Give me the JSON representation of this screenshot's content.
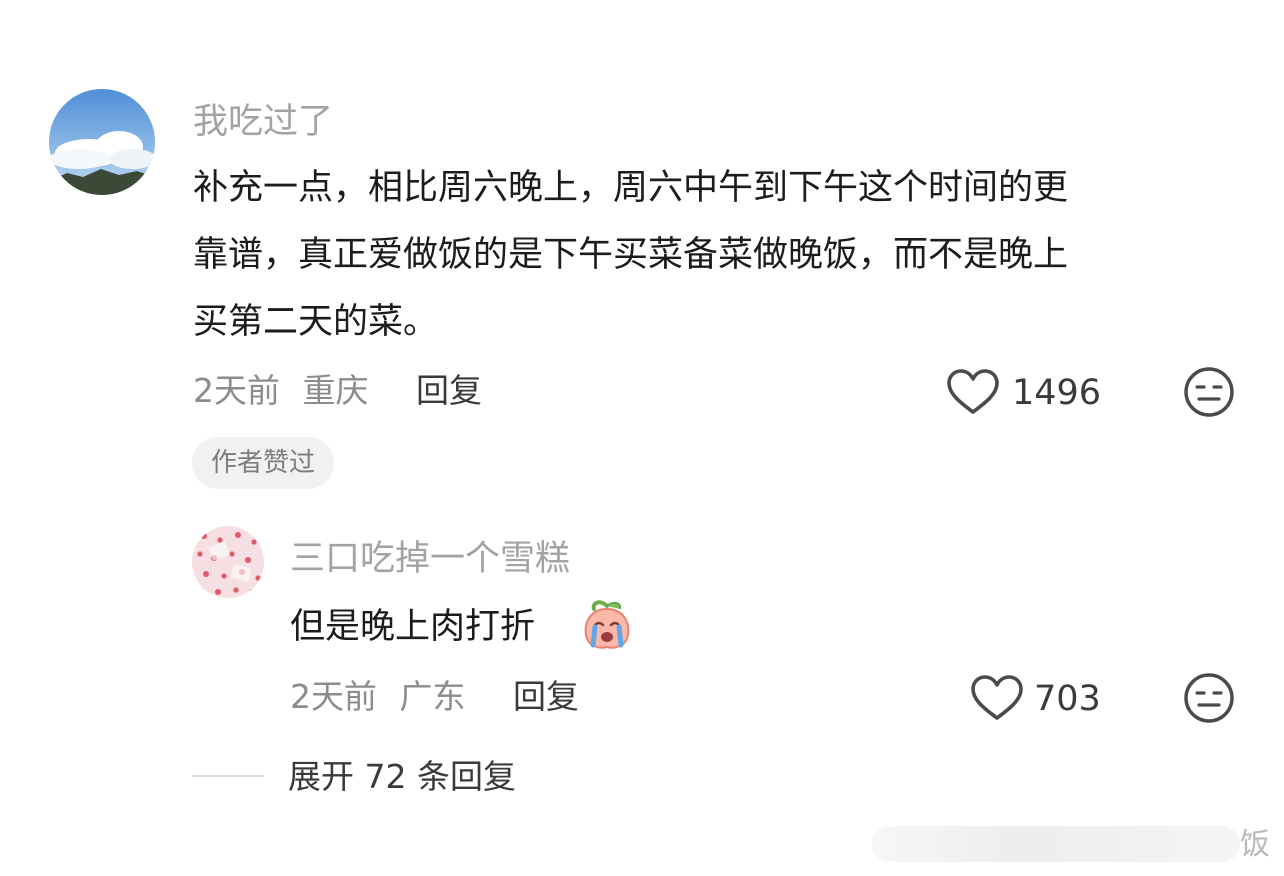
{
  "comment": {
    "username": "我吃过了",
    "lines": [
      "补充一点，相比周六晚上，周六中午到下午这个时间的更",
      "靠谱，真正爱做饭的是下午买菜备菜做晚饭，而不是晚上",
      "买第二天的菜。"
    ],
    "time": "2天前",
    "location": "重庆",
    "reply_label": "回复",
    "like_count": "1496",
    "badge": "作者赞过"
  },
  "reply": {
    "username": "三口吃掉一个雪糕",
    "text": "但是晚上肉打折",
    "emoji": "crying-peach-emoji",
    "time": "2天前",
    "location": "广东",
    "reply_label": "回复",
    "like_count": "703"
  },
  "expand": {
    "label": "展开 72 条回复"
  },
  "watermark": {
    "text": "饭"
  },
  "icons": {
    "like": "heart-icon",
    "dislike": "neutral-face-icon"
  },
  "colors": {
    "username": "#a3a3a3",
    "badge_bg": "#f1f1f1",
    "text": "#1c1c1c"
  }
}
